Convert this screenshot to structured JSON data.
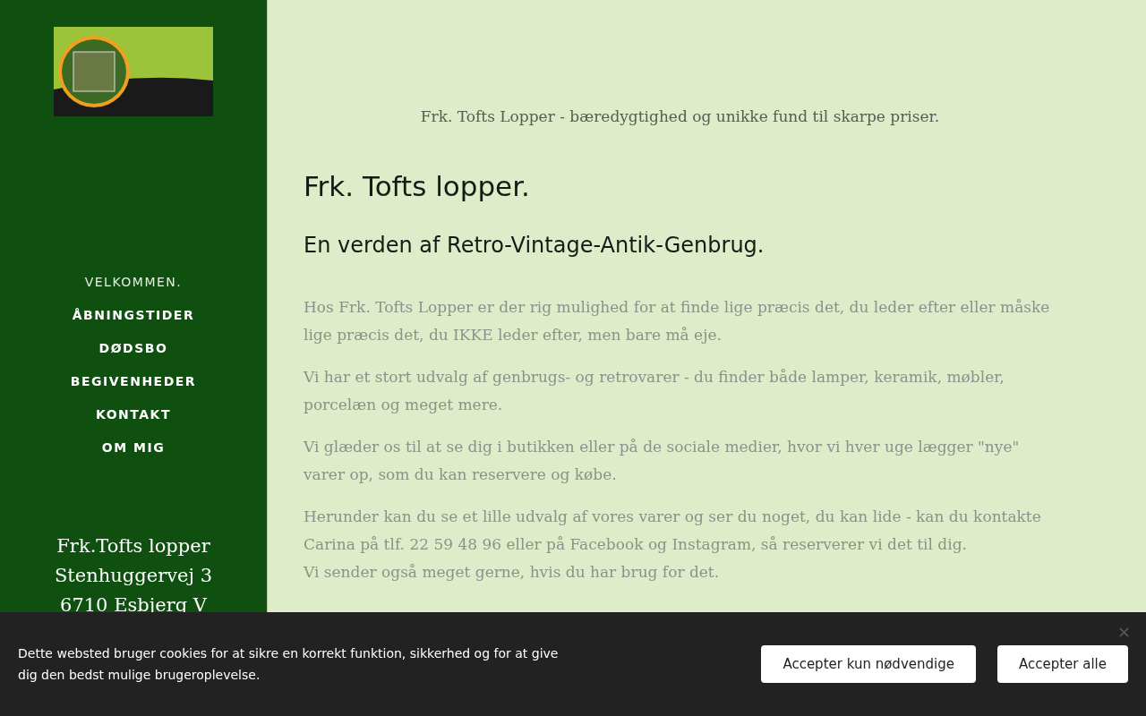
{
  "sidebar": {
    "nav": [
      {
        "label": "VELKOMMEN.",
        "selected": true
      },
      {
        "label": "ÅBNINGSTIDER",
        "selected": false
      },
      {
        "label": "DØDSBO",
        "selected": false
      },
      {
        "label": "BEGIVENHEDER",
        "selected": false
      },
      {
        "label": "KONTAKT",
        "selected": false
      },
      {
        "label": "OM MIG",
        "selected": false
      }
    ],
    "address": [
      "Frk.Tofts lopper",
      "Stenhuggervej 3",
      "6710 Esbjerg V"
    ]
  },
  "main": {
    "tagline": "Frk. Tofts Lopper - bæredygtighed og unikke fund til skarpe priser.",
    "title": "Frk. Tofts lopper.",
    "subtitle": "En verden af Retro-Vintage-Antik-Genbrug.",
    "paragraphs": [
      [
        "Hos Frk. Tofts Lopper er der rig mulighed for at finde lige præcis det, du leder efter eller måske lige præcis det, du IKKE leder efter, men bare må eje."
      ],
      [
        "Vi har et stort udvalg af genbrugs- og retrovarer - du finder både lamper, keramik, møbler, porcelæn og meget mere."
      ],
      [
        "Vi glæder os til at se dig i butikken eller på de sociale medier, hvor vi hver uge lægger \"nye\" varer op, som du kan reservere og købe."
      ],
      [
        "Herunder kan du se et lille udvalg af vores varer og ser du noget, du kan lide - kan du kontakte Carina på tlf. 22 59 48 96 eller på Facebook og Instagram, så reserverer vi det til dig.",
        "Vi sender også meget gerne, hvis du har brug for det."
      ]
    ]
  },
  "cookie_bar": {
    "text": "Dette websted bruger cookies for at sikre en korrekt funktion, sikkerhed og for at give dig den bedst mulige brugeroplevelse.",
    "buttons": [
      "Accepter kun nødvendige",
      "Accepter alle"
    ]
  }
}
